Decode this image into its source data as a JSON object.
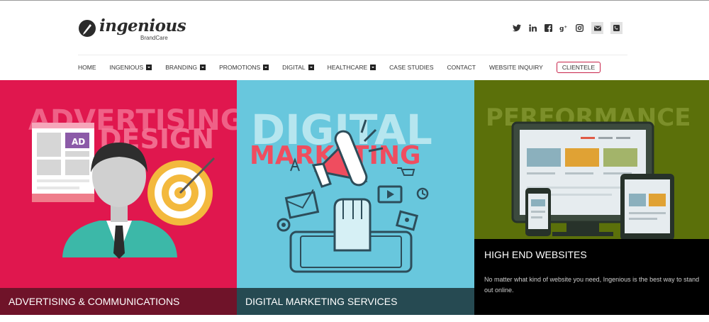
{
  "brand": {
    "name": "ingenious",
    "tagline": "BrandCare"
  },
  "social_icons": [
    "twitter-icon",
    "linkedin-icon",
    "facebook-icon",
    "google-plus-icon",
    "instagram-icon",
    "email-icon",
    "phone-icon"
  ],
  "nav": {
    "items": [
      {
        "label": "HOME",
        "has_dropdown": false
      },
      {
        "label": "INGENIOUS",
        "has_dropdown": true
      },
      {
        "label": "BRANDING",
        "has_dropdown": true
      },
      {
        "label": "PROMOTIONS",
        "has_dropdown": true
      },
      {
        "label": "DIGITAL",
        "has_dropdown": true
      },
      {
        "label": "HEALTHCARE",
        "has_dropdown": true
      },
      {
        "label": "CASE STUDIES",
        "has_dropdown": false
      },
      {
        "label": "CONTACT",
        "has_dropdown": false
      },
      {
        "label": "WEBSITE INQUIRY",
        "has_dropdown": false
      }
    ],
    "cta": "CLIENTELE"
  },
  "panels": {
    "advertising": {
      "art_line1": "ADVERTISING",
      "art_line2": "DESIGN",
      "ad_badge": "AD",
      "caption": "ADVERTISING & COMMUNICATIONS"
    },
    "digital": {
      "art_line1": "DIGITAL",
      "art_line2": "MARKETING",
      "caption": "DIGITAL MARKETING SERVICES"
    },
    "websites": {
      "art_line1": "PERFORMANCE",
      "title": "HIGH END WEBSITES",
      "description": "No matter what kind of website you need, Ingenious is the best way to stand out online."
    }
  },
  "colors": {
    "advertising_bg": "#e0174e",
    "digital_bg": "#68c7dd",
    "websites_bg": "#5b700a",
    "cta_border": "#c8234a"
  }
}
